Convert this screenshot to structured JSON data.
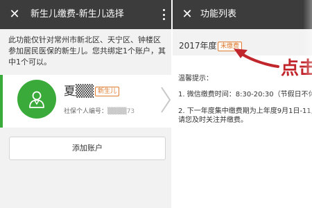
{
  "left_screen": {
    "header": {
      "title": "新生儿缴费-新生儿选择",
      "close_glyph": "✕",
      "menu_icon": "more-vertical-icon"
    },
    "notice": "此功能仅针对常州市新北区、天宁区、钟楼区参加居民医保的新生儿。您共绑定1个账户，其中1个可以。",
    "account": {
      "name": "夏▒▒",
      "tag": "新生儿",
      "id_label": "社保个人编号：",
      "id_value": "▒▒▒▒73",
      "avatar_icon": "person-icon",
      "chevron_icon": "chevron-right-icon"
    },
    "add_account_label": "添加账户"
  },
  "right_screen": {
    "header": {
      "title": "功能列表",
      "close_glyph": "✕"
    },
    "year": "2017年度",
    "status_tag": "未缴费",
    "tips": {
      "heading": "温馨提示：",
      "line1": "1. 微信缴费时间：8:30-20:30（节假日不休息）",
      "line2": "2. 下一年度集中缴费期为上年度9月1日-11月2",
      "line3": "请您及时关注并缴费。"
    },
    "annotation": "点击"
  },
  "colors": {
    "header_bg": "#3c3c3c",
    "green": "#3aab3a",
    "tag_orange": "#e07a2e",
    "annotation_red": "#c0262b",
    "page_bg": "#f2f2f2"
  }
}
